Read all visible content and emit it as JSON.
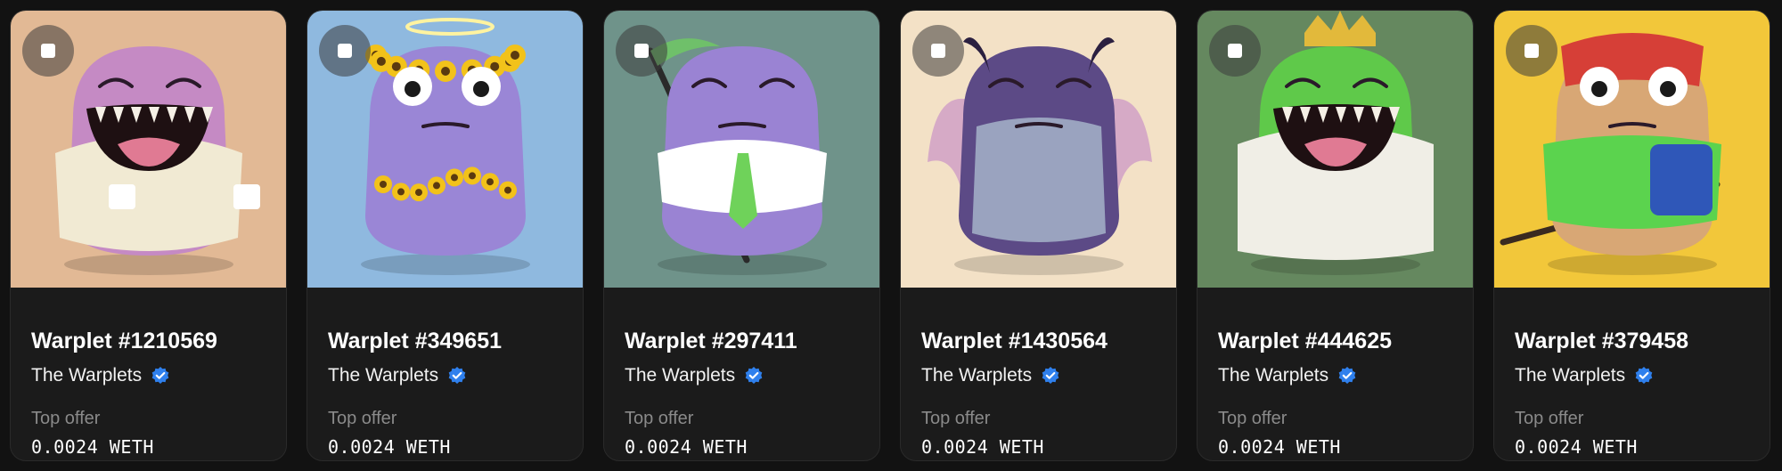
{
  "cards": [
    {
      "name": "Warplet #1210569",
      "collection": "The Warplets",
      "offer_label": "Top offer",
      "offer_value": "0.0024 WETH",
      "bg": "#e2b995",
      "body": "#c58ac4",
      "accent": "#f1ead3",
      "art": "monster-in-sweater-with-coffee"
    },
    {
      "name": "Warplet #349651",
      "collection": "The Warplets",
      "offer_label": "Top offer",
      "offer_value": "0.0024 WETH",
      "bg": "#8fb9df",
      "body": "#9a86d6",
      "accent": "#f2c21a",
      "art": "monster-with-sunflower-crown-and-halo"
    },
    {
      "name": "Warplet #297411",
      "collection": "The Warplets",
      "offer_label": "Top offer",
      "offer_value": "0.0024 WETH",
      "bg": "#6f938a",
      "body": "#9a83d3",
      "accent": "#ffffff",
      "art": "monster-with-scythe-and-tie"
    },
    {
      "name": "Warplet #1430564",
      "collection": "The Warplets",
      "offer_label": "Top offer",
      "offer_value": "0.0024 WETH",
      "bg": "#f3e1c6",
      "body": "#5c4a86",
      "accent": "#d3a4c5",
      "art": "armored-monster-with-wings"
    },
    {
      "name": "Warplet #444625",
      "collection": "The Warplets",
      "offer_label": "Top offer",
      "offer_value": "0.0024 WETH",
      "bg": "#65885f",
      "body": "#5fc94a",
      "accent": "#f0eee6",
      "art": "frog-king-in-robe"
    },
    {
      "name": "Warplet #379458",
      "collection": "The Warplets",
      "offer_label": "Top offer",
      "offer_value": "0.0024 WETH",
      "bg": "#f2c73a",
      "body": "#d8a775",
      "accent": "#d63f37",
      "art": "monster-in-hat-with-sword"
    }
  ],
  "colors": {
    "verified": "#2f80ed",
    "page_bg": "#121212",
    "card_bg": "#1b1b1b"
  }
}
